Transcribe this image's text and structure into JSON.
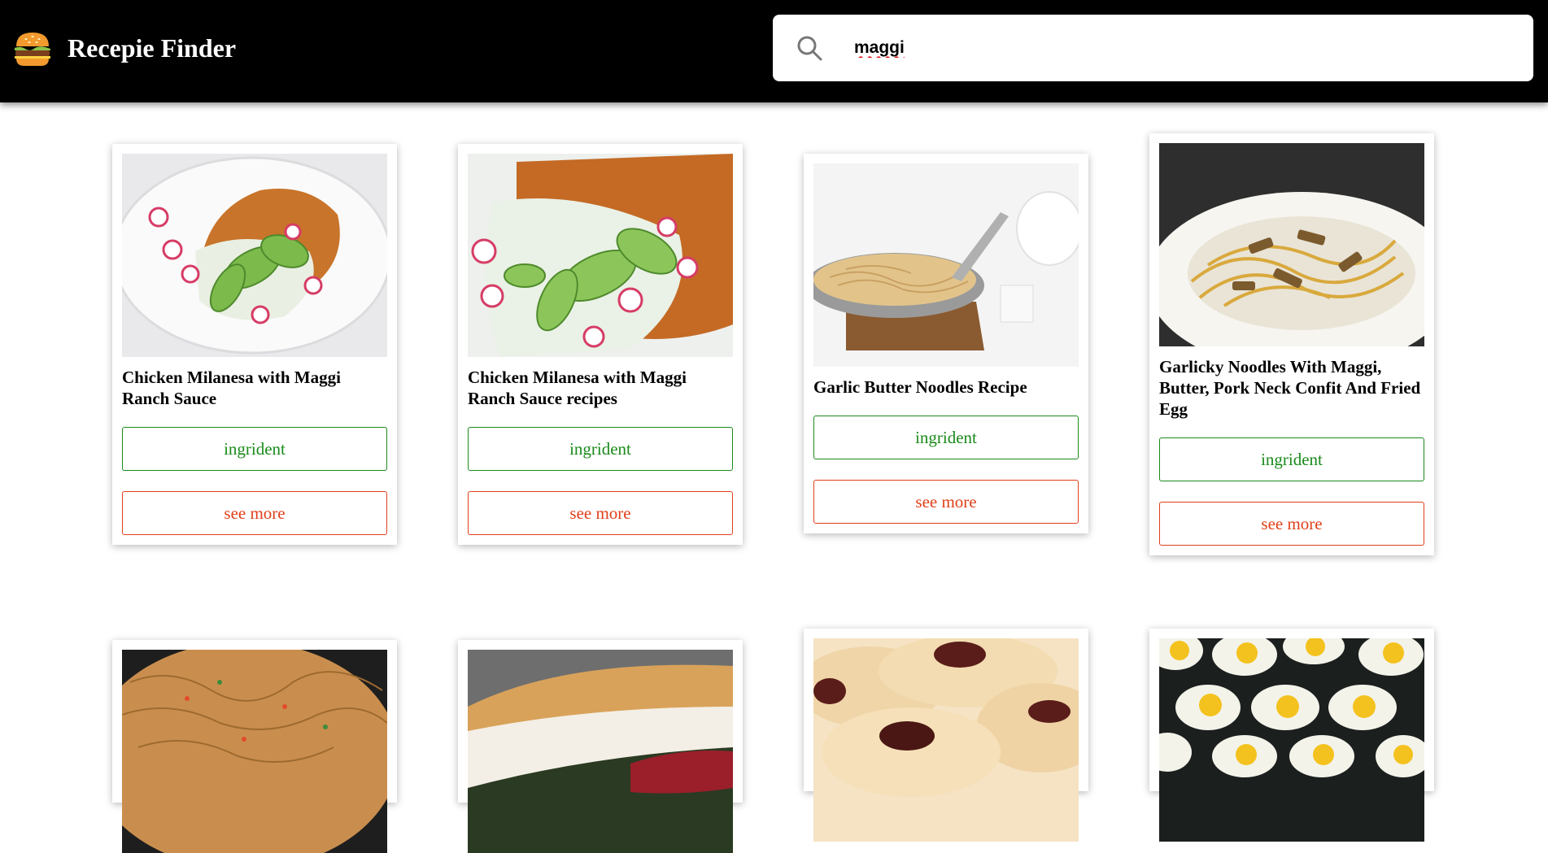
{
  "header": {
    "app_title": "Recepie Finder",
    "logo_icon": "burger-icon"
  },
  "search": {
    "icon": "search-icon",
    "value": "maggi"
  },
  "recipes": [
    {
      "title": "Chicken Milanesa with Maggi Ranch Sauce",
      "ingredient_label": "ingrident",
      "more_label": "see more",
      "image": "chicken-milanesa-plate"
    },
    {
      "title": "Chicken Milanesa with Maggi Ranch Sauce recipes",
      "ingredient_label": "ingrident",
      "more_label": "see more",
      "image": "chicken-milanesa-closeup"
    },
    {
      "title": "Garlic Butter Noodles Recipe",
      "ingredient_label": "ingrident",
      "more_label": "see more",
      "image": "noodles-in-pan"
    },
    {
      "title": "Garlicky Noodles With Maggi, Butter, Pork Neck Confit And Fried Egg",
      "ingredient_label": "ingrident",
      "more_label": "see more",
      "image": "noodles-bowl"
    },
    {
      "image": "fried-noodles-wok"
    },
    {
      "image": "baguette-sandwich"
    },
    {
      "image": "jam-cookies"
    },
    {
      "image": "quail-eggs"
    }
  ],
  "colors": {
    "header_bg": "#000000",
    "ingredient": "#1a8a1a",
    "more": "#e0401a"
  }
}
